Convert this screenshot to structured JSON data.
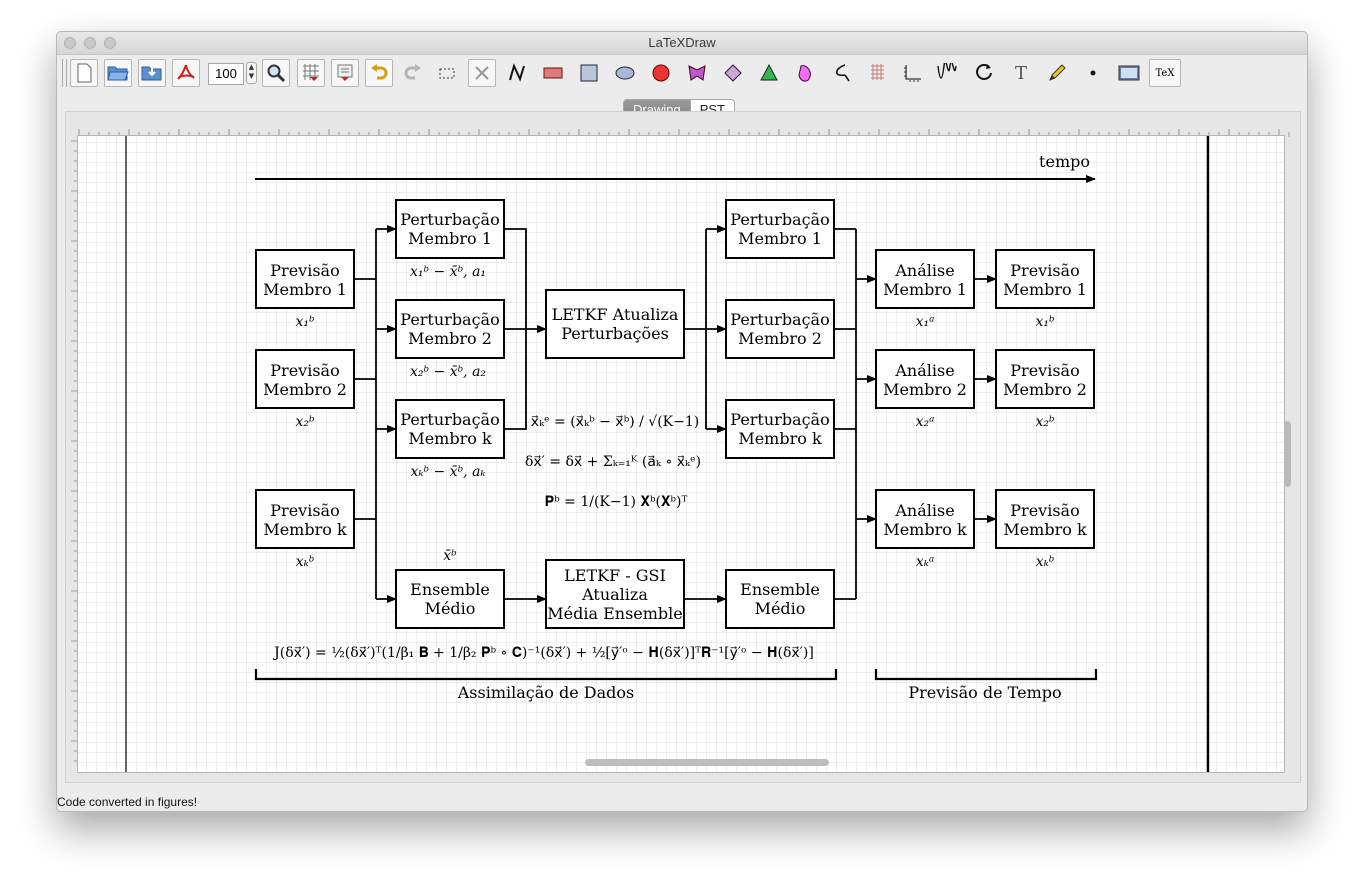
{
  "window": {
    "title": "LaTeXDraw"
  },
  "toolbar": {
    "zoom_value": "100",
    "tools": [
      "new-file",
      "open-file",
      "save-file",
      "export-pdf",
      "zoom",
      "grid",
      "magnetic-grid",
      "undo",
      "redo",
      "select",
      "delete",
      "lines",
      "rectangle",
      "square",
      "ellipse",
      "circle",
      "polygon",
      "rhombus",
      "triangle",
      "freehand-shape",
      "arc",
      "grid-shape",
      "axes",
      "bezier",
      "circle-arrow",
      "text",
      "pencil",
      "dot",
      "picture",
      "tex"
    ],
    "tex_label": "TeX",
    "text_tool_glyph": "T"
  },
  "view_tabs": {
    "drawing": "Drawing",
    "pst": "PST"
  },
  "status": {
    "message": "Code converted in figures!"
  },
  "diagram": {
    "tempo": "tempo",
    "prev1_l1": "Previsão",
    "prev1_l2": "Membro 1",
    "prev1_sub": "x₁ᵇ",
    "prev2_l1": "Previsão",
    "prev2_l2": "Membro 2",
    "prev2_sub": "x₂ᵇ",
    "prevk_l1": "Previsão",
    "prevk_l2": "Membro k",
    "prevk_sub": "xₖᵇ",
    "pert1_l1": "Perturbação",
    "pert1_l2": "Membro 1",
    "pert1_sub": "x₁ᵇ − x̄ᵇ, a₁",
    "pert2_l1": "Perturbação",
    "pert2_l2": "Membro 2",
    "pert2_sub": "x₂ᵇ − x̄ᵇ, a₂",
    "pertk_l1": "Perturbação",
    "pertk_l2": "Membro k",
    "pertk_sub": "xₖᵇ − x̄ᵇ, aₖ",
    "letkf_l1": "LETKF Atualiza",
    "letkf_l2": "Perturbações",
    "rpert1_l1": "Perturbação",
    "rpert1_l2": "Membro 1",
    "rpert2_l1": "Perturbação",
    "rpert2_l2": "Membro 2",
    "rpertk_l1": "Perturbação",
    "rpertk_l2": "Membro k",
    "ens_mean_label": "x̄ᵇ",
    "ens1_l1": "Ensemble",
    "ens1_l2": "Médio",
    "gsi_l1": "LETKF - GSI",
    "gsi_l2": "Atualiza",
    "gsi_l3": "Média Ensemble",
    "ens2_l1": "Ensemble",
    "ens2_l2": "Médio",
    "an1_l1": "Análise",
    "an1_l2": "Membro 1",
    "an1_sub": "x₁ᵃ",
    "an2_l1": "Análise",
    "an2_l2": "Membro 2",
    "an2_sub": "x₂ᵃ",
    "ank_l1": "Análise",
    "ank_l2": "Membro k",
    "ank_sub": "xₖᵃ",
    "fc1_l1": "Previsão",
    "fc1_l2": "Membro 1",
    "fc1_sub": "x₁ᵇ",
    "fc2_l1": "Previsão",
    "fc2_l2": "Membro 2",
    "fc2_sub": "x₂ᵇ",
    "fck_l1": "Previsão",
    "fck_l2": "Membro k",
    "fck_sub": "xₖᵇ",
    "formula_xe": "x⃗ₖᵉ = (x⃗ₖᵇ − x⃗ᵇ) / √(K−1)",
    "formula_dx": "δx⃗′ = δx⃗ + Σₖ₌₁ᴷ (a⃗ₖ ∘ x⃗ₖᵉ)",
    "formula_pb": "𝐏ᵇ = 1/(K−1) 𝐗ᵇ(𝐗ᵇ)ᵀ",
    "formula_j": "J(δx⃗′) = ½(δx⃗′)ᵀ(1/β₁ 𝐁 + 1/β₂ 𝐏ᵇ ∘ 𝐂)⁻¹(δx⃗′) + ½[y⃗′ᵒ − 𝐇(δx⃗′)]ᵀ𝐑⁻¹[y⃗′ᵒ − 𝐇(δx⃗′)]",
    "assim_label": "Assimilação de Dados",
    "prev_tempo_label": "Previsão de Tempo"
  }
}
